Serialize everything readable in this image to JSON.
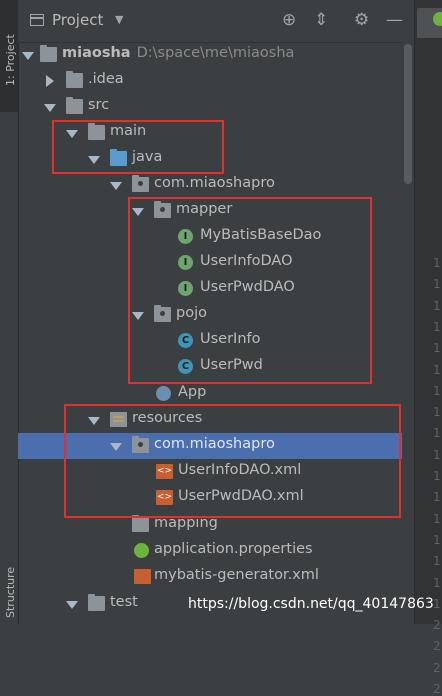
{
  "sidebar": {
    "project_tab": "1: Project",
    "structure_tab": "Structure"
  },
  "header": {
    "title": "Project"
  },
  "tree": {
    "root": {
      "name": "miaosha",
      "path": "D:\\space\\me\\miaosha"
    },
    "idea": ".idea",
    "src": "src",
    "main": "main",
    "java": "java",
    "com_pkg": "com.miaoshapro",
    "mapper": "mapper",
    "mybatis_base_dao": "MyBatisBaseDao",
    "user_info_dao": "UserInfoDAO",
    "user_pwd_dao": "UserPwdDAO",
    "pojo": "pojo",
    "user_info": "UserInfo",
    "user_pwd": "UserPwd",
    "app": "App",
    "resources": "resources",
    "res_pkg": "com.miaoshapro",
    "user_info_dao_xml": "UserInfoDAO.xml",
    "user_pwd_dao_xml": "UserPwdDAO.xml",
    "mapping": "mapping",
    "app_props": "application.properties",
    "mybatis_gen": "mybatis-generator.xml",
    "test": "test"
  },
  "icons": {
    "interface_letter": "I",
    "class_letter": "C",
    "xml_glyph": "<>"
  },
  "editor": {
    "gutter": [
      "1",
      "1",
      "1",
      "1",
      "1",
      "1",
      "1",
      "1",
      "1",
      "1",
      "1",
      "1",
      "1",
      "1",
      "1",
      "1",
      "1",
      "2",
      "2",
      "2",
      "2"
    ]
  },
  "watermark": "https://blog.csdn.net/qq_40147863",
  "colors": {
    "background": "#3c3f41",
    "selection": "#4b6eaf",
    "highlight_box": "#e03030",
    "source_folder": "#5a9bd0"
  }
}
